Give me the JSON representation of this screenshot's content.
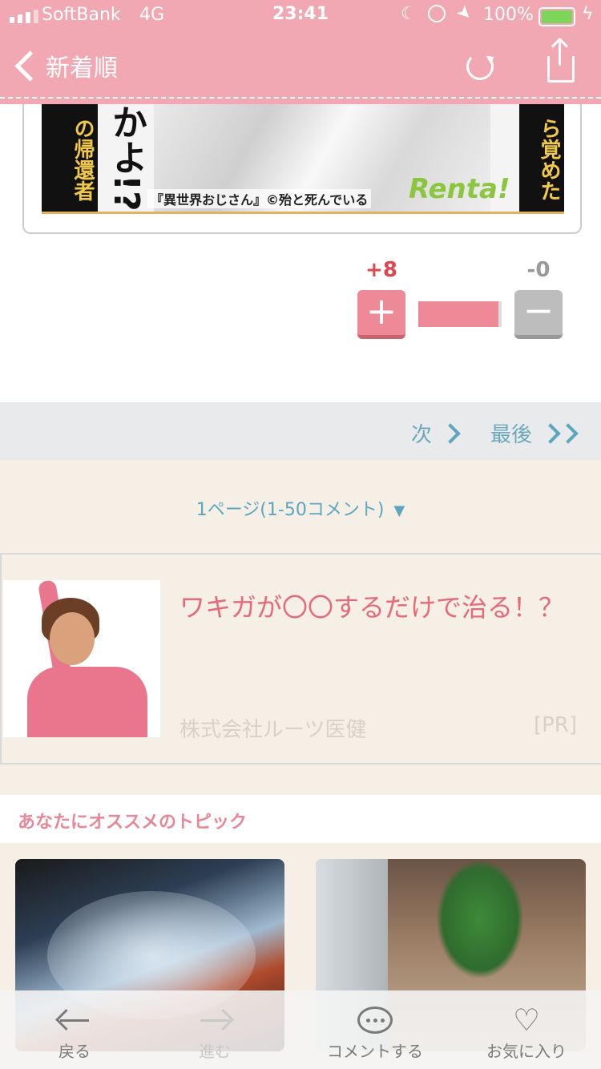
{
  "status": {
    "carrier": "SoftBank",
    "network": "4G",
    "time": "23:41",
    "battery": "100%"
  },
  "nav": {
    "back_label": "新着順"
  },
  "article_image": {
    "credit": "『異世界おじさん』©殆と死んでいる",
    "left_text": "の帰還者",
    "mid_text": "かよ!?",
    "right_text": "ら覚めた",
    "brand": "Renta!"
  },
  "vote": {
    "plus_count": "+8",
    "minus_count": "-0",
    "plus_symbol": "+",
    "minus_symbol": "−",
    "ratio_percent": 96
  },
  "pager": {
    "next_label": "次",
    "last_label": "最後"
  },
  "page_info": {
    "label": "1ページ(1-50コメント)",
    "arrow": "▼"
  },
  "ad": {
    "title": "ワキガが〇〇するだけで治る！？",
    "company": "株式会社ルーツ医健",
    "tag": "[PR]"
  },
  "recommend": {
    "title": "あなたにオススメのトピック"
  },
  "toolbar": {
    "back": "戻る",
    "forward": "進む",
    "comment": "コメントする",
    "favorite": "お気に入り"
  },
  "colors": {
    "header": "#f2a8b3",
    "accent_pink": "#e46a7a",
    "link_blue": "#5ca6c0",
    "background": "#f5efe6"
  }
}
